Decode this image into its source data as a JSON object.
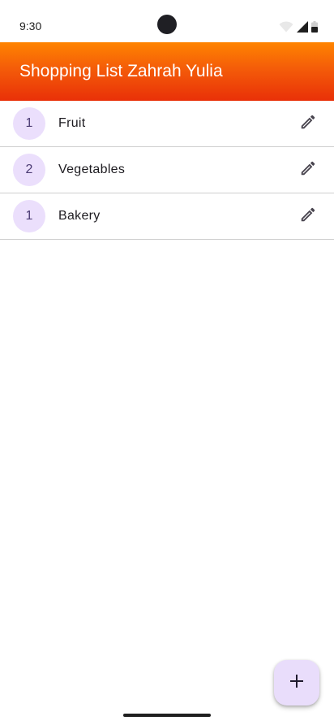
{
  "status_bar": {
    "time": "9:30",
    "icons": [
      "wifi-icon",
      "signal-icon",
      "battery-icon"
    ]
  },
  "app_bar": {
    "title": "Shopping List Zahrah Yulia",
    "gradient_colors": [
      "#ff8400",
      "#e93008"
    ]
  },
  "list": {
    "items": [
      {
        "count": "1",
        "label": "Fruit",
        "action_icon": "edit-icon"
      },
      {
        "count": "2",
        "label": "Vegetables",
        "action_icon": "edit-icon"
      },
      {
        "count": "1",
        "label": "Bakery",
        "action_icon": "edit-icon"
      }
    ]
  },
  "fab": {
    "icon": "add-icon",
    "color": "#e9ddfb"
  },
  "colors": {
    "avatar_bg": "#ebdffc",
    "avatar_text": "#4b3b73",
    "divider": "#cfcfcf"
  }
}
